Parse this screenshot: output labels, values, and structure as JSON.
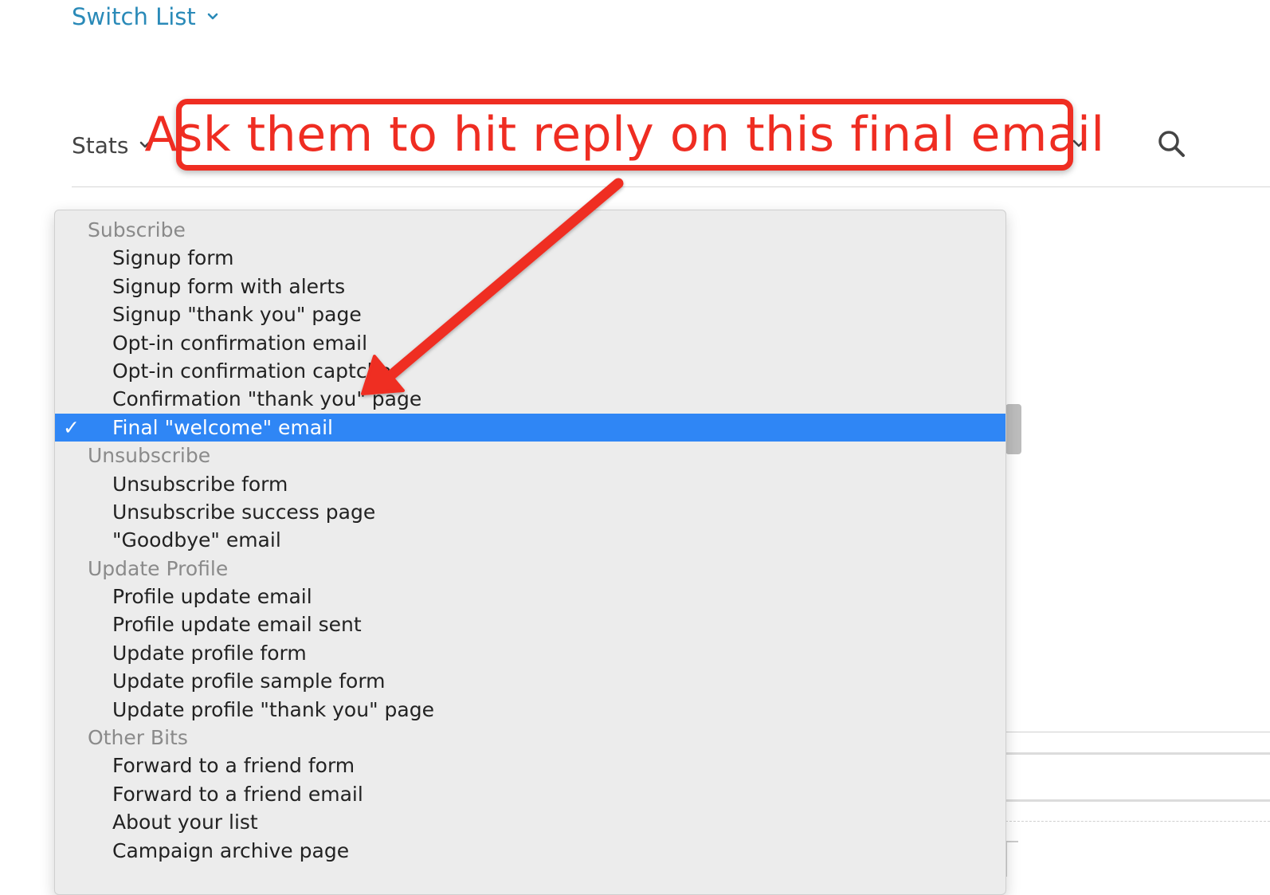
{
  "header": {
    "switch_list_label": "Switch List"
  },
  "toolbar": {
    "stats_label": "Stats"
  },
  "dropdown": {
    "groups": [
      {
        "header": "Subscribe",
        "items": [
          "Signup form",
          "Signup form with alerts",
          "Signup \"thank you\" page",
          "Opt-in confirmation email",
          "Opt-in confirmation captcha",
          "Confirmation \"thank you\" page",
          "Final \"welcome\" email"
        ]
      },
      {
        "header": "Unsubscribe",
        "items": [
          "Unsubscribe form",
          "Unsubscribe success page",
          "\"Goodbye\" email"
        ]
      },
      {
        "header": "Update Profile",
        "items": [
          "Profile update email",
          "Profile update email sent",
          "Update profile form",
          "Update profile sample form",
          "Update profile \"thank you\" page"
        ]
      },
      {
        "header": "Other Bits",
        "items": [
          "Forward to a friend form",
          "Forward to a friend email",
          "About your list",
          "Campaign archive page"
        ]
      }
    ],
    "selected_item": "Final \"welcome\" email",
    "check_mark": "✓"
  },
  "annotation": {
    "callout_text": "Ask them to hit reply on this final email",
    "color": "#ef2d22"
  },
  "colors": {
    "link": "#2a8ab8",
    "selection": "#2f86f5"
  },
  "icons": {
    "switch_list_chevron": "chevron-down-icon",
    "stats_chevron": "chevron-down-icon",
    "search": "search-icon",
    "selected_check": "checkmark-icon"
  }
}
